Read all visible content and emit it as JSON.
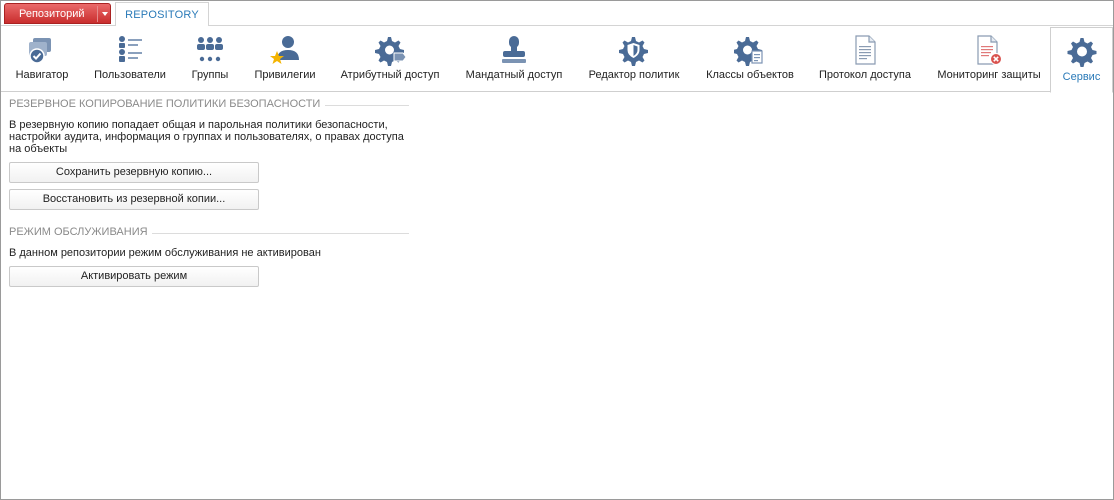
{
  "topbar": {
    "repo_button": "Репозиторий",
    "doc_tab": "REPOSITORY"
  },
  "ribbon": {
    "items": [
      {
        "label": "Навигатор",
        "icon": "navigator-icon"
      },
      {
        "label": "Пользователи",
        "icon": "users-list-icon"
      },
      {
        "label": "Группы",
        "icon": "groups-icon"
      },
      {
        "label": "Привилегии",
        "icon": "privileges-icon"
      },
      {
        "label": "Атрибутный доступ",
        "icon": "attribute-access-icon"
      },
      {
        "label": "Мандатный доступ",
        "icon": "mandatory-access-icon"
      },
      {
        "label": "Редактор политик",
        "icon": "policy-editor-icon"
      },
      {
        "label": "Классы объектов",
        "icon": "object-classes-icon"
      },
      {
        "label": "Протокол доступа",
        "icon": "access-log-icon"
      },
      {
        "label": "Мониторинг защиты",
        "icon": "security-monitoring-icon"
      },
      {
        "label": "Сервис",
        "icon": "service-gear-icon",
        "active": true
      }
    ]
  },
  "backup": {
    "title": "РЕЗЕРВНОЕ КОПИРОВАНИЕ ПОЛИТИКИ БЕЗОПАСНОСТИ",
    "description_lines": [
      "В резервную копию попадает общая и парольная политики безопасности,",
      "настройки аудита, информация о группах и пользователях, о правах доступа",
      "на объекты"
    ],
    "save_button": "Сохранить резервную копию...",
    "restore_button": "Восстановить из резервной копии..."
  },
  "maintenance": {
    "title": "РЕЖИМ ОБСЛУЖИВАНИЯ",
    "status_text": "В данном репозитории режим обслуживания не активирован",
    "activate_button": "Активировать режим"
  },
  "colors": {
    "accent": "#2a7ab8",
    "repo_button": "#d13c3c",
    "icon_blue": "#4a6b96"
  }
}
